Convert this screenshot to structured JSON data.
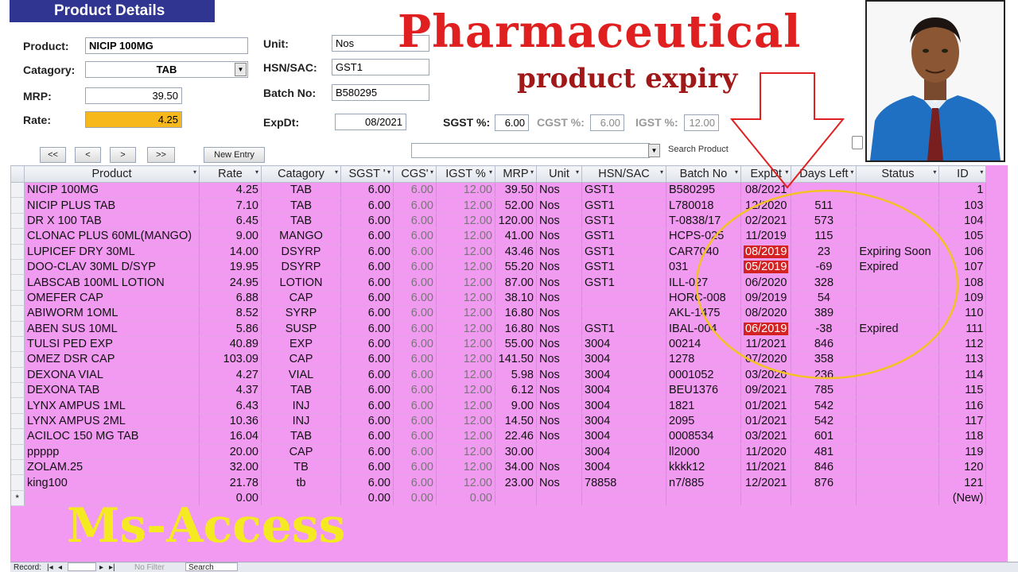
{
  "form": {
    "title": "Product Details",
    "product_label": "Product:",
    "product_value": "NICIP 100MG",
    "category_label": "Catagory:",
    "category_value": "TAB",
    "mrp_label": "MRP:",
    "mrp_value": "39.50",
    "rate_label": "Rate:",
    "rate_value": "4.25",
    "unit_label": "Unit:",
    "unit_value": "Nos",
    "hsn_label": "HSN/SAC:",
    "hsn_value": "GST1",
    "batch_label": "Batch No:",
    "batch_value": "B580295",
    "expdt_label": "ExpDt:",
    "expdt_value": "08/2021",
    "sgst_label": "SGST %:",
    "sgst_value": "6.00",
    "cgst_label": "CGST %:",
    "cgst_value": "6.00",
    "igst_label": "IGST %:",
    "igst_value": "12.00"
  },
  "nav": {
    "first": "<<",
    "prev": "<",
    "next": ">",
    "last": ">>",
    "new_entry": "New Entry",
    "search_label": "Search Product",
    "search_value": ""
  },
  "overlay": {
    "title": "Pharmaceutical",
    "subtitle": "product expiry",
    "footer_title": "Ms-Access"
  },
  "table": {
    "columns": [
      "Product",
      "Rate",
      "Catagory",
      "SGST '",
      "CGS'",
      "IGST %",
      "MRP",
      "Unit",
      "HSN/SAC",
      "Batch No",
      "ExpDt",
      "Days Left",
      "Status",
      "ID"
    ],
    "rows": [
      [
        "NICIP 100MG",
        "4.25",
        "TAB",
        "6.00",
        "6.00",
        "12.00",
        "39.50",
        "Nos",
        "GST1",
        "B580295",
        "08/2021",
        "",
        "",
        "1"
      ],
      [
        "NICIP PLUS TAB",
        "7.10",
        "TAB",
        "6.00",
        "6.00",
        "12.00",
        "52.00",
        "Nos",
        "GST1",
        "L780018",
        "12/2020",
        "511",
        "",
        "103"
      ],
      [
        "DR X 100 TAB",
        "6.45",
        "TAB",
        "6.00",
        "6.00",
        "12.00",
        "120.00",
        "Nos",
        "GST1",
        "T-0838/17",
        "02/2021",
        "573",
        "",
        "104"
      ],
      [
        "CLONAC PLUS 60ML(MANGO)",
        "9.00",
        "MANGO",
        "6.00",
        "6.00",
        "12.00",
        "41.00",
        "Nos",
        "GST1",
        "HCPS-025",
        "11/2019",
        "115",
        "",
        "105"
      ],
      [
        "LUPICEF DRY 30ML",
        "14.00",
        "DSYRP",
        "6.00",
        "6.00",
        "12.00",
        "43.46",
        "Nos",
        "GST1",
        "CAR7040",
        "08/2019",
        "23",
        "Expiring Soon",
        "106"
      ],
      [
        "DOO-CLAV 30ML D/SYP",
        "19.95",
        "DSYRP",
        "6.00",
        "6.00",
        "12.00",
        "55.20",
        "Nos",
        "GST1",
        "031",
        "05/2019",
        "-69",
        "Expired",
        "107"
      ],
      [
        "LABSCAB 100ML LOTION",
        "24.95",
        "LOTION",
        "6.00",
        "6.00",
        "12.00",
        "87.00",
        "Nos",
        "GST1",
        "ILL-027",
        "06/2020",
        "328",
        "",
        "108"
      ],
      [
        "OMEFER CAP",
        "6.88",
        "CAP",
        "6.00",
        "6.00",
        "12.00",
        "38.10",
        "Nos",
        "",
        "HORC-008",
        "09/2019",
        "54",
        "",
        "109"
      ],
      [
        "ABIWORM 1OML",
        "8.52",
        "SYRP",
        "6.00",
        "6.00",
        "12.00",
        "16.80",
        "Nos",
        "",
        "AKL-1475",
        "08/2020",
        "389",
        "",
        "110"
      ],
      [
        "ABEN SUS 10ML",
        "5.86",
        "SUSP",
        "6.00",
        "6.00",
        "12.00",
        "16.80",
        "Nos",
        "GST1",
        "IBAL-004",
        "06/2019",
        "-38",
        "Expired",
        "111"
      ],
      [
        "TULSI PED EXP",
        "40.89",
        "EXP",
        "6.00",
        "6.00",
        "12.00",
        "55.00",
        "Nos",
        "3004",
        "00214",
        "11/2021",
        "846",
        "",
        "112"
      ],
      [
        "OMEZ DSR CAP",
        "103.09",
        "CAP",
        "6.00",
        "6.00",
        "12.00",
        "141.50",
        "Nos",
        "3004",
        "1278",
        "07/2020",
        "358",
        "",
        "113"
      ],
      [
        "DEXONA VIAL",
        "4.27",
        "VIAL",
        "6.00",
        "6.00",
        "12.00",
        "5.98",
        "Nos",
        "3004",
        "0001052",
        "03/2020",
        "236",
        "",
        "114"
      ],
      [
        "DEXONA TAB",
        "4.37",
        "TAB",
        "6.00",
        "6.00",
        "12.00",
        "6.12",
        "Nos",
        "3004",
        "BEU1376",
        "09/2021",
        "785",
        "",
        "115"
      ],
      [
        "LYNX AMPUS 1ML",
        "6.43",
        "INJ",
        "6.00",
        "6.00",
        "12.00",
        "9.00",
        "Nos",
        "3004",
        "1821",
        "01/2021",
        "542",
        "",
        "116"
      ],
      [
        "LYNX AMPUS 2ML",
        "10.36",
        "INJ",
        "6.00",
        "6.00",
        "12.00",
        "14.50",
        "Nos",
        "3004",
        "2095",
        "01/2021",
        "542",
        "",
        "117"
      ],
      [
        "ACILOC 150 MG TAB",
        "16.04",
        "TAB",
        "6.00",
        "6.00",
        "12.00",
        "22.46",
        "Nos",
        "3004",
        "0008534",
        "03/2021",
        "601",
        "",
        "118"
      ],
      [
        "ppppp",
        "20.00",
        "CAP",
        "6.00",
        "6.00",
        "12.00",
        "30.00",
        "",
        "3004",
        "ll2000",
        "11/2020",
        "481",
        "",
        "119"
      ],
      [
        "ZOLAM.25",
        "32.00",
        "TB",
        "6.00",
        "6.00",
        "12.00",
        "34.00",
        "Nos",
        "3004",
        "kkkk12",
        "11/2021",
        "846",
        "",
        "120"
      ],
      [
        "king100",
        "21.78",
        "tb",
        "6.00",
        "6.00",
        "12.00",
        "23.00",
        "Nos",
        "78858",
        "n7/885",
        "12/2021",
        "876",
        "",
        "121"
      ]
    ],
    "expired_rows": [
      4,
      5,
      9
    ],
    "new_row": [
      "",
      "0.00",
      "",
      "0.00",
      "0.00",
      "0.00",
      "",
      "",
      "",
      "",
      "",
      "",
      "",
      "(New)"
    ],
    "new_row_marker": "*"
  },
  "statusbar": {
    "record_label": "Record:",
    "nav_first": "|◂",
    "nav_prev": "◂",
    "nav_next": "▸",
    "nav_last": "▸|",
    "no_filter": "No Filter",
    "search": "Search"
  },
  "colors": {
    "sheet_bg": "#f29af2",
    "title_red": "#e02020",
    "expired_red": "#d42222",
    "rate_orange": "#f7b81c",
    "footer_yellow": "#f5ea21",
    "header_blue": "#2f3590"
  },
  "icons": {
    "dropdown": "chevron-down-icon",
    "arrow": "down-arrow-icon",
    "sort": "sort-arrow-icon"
  }
}
